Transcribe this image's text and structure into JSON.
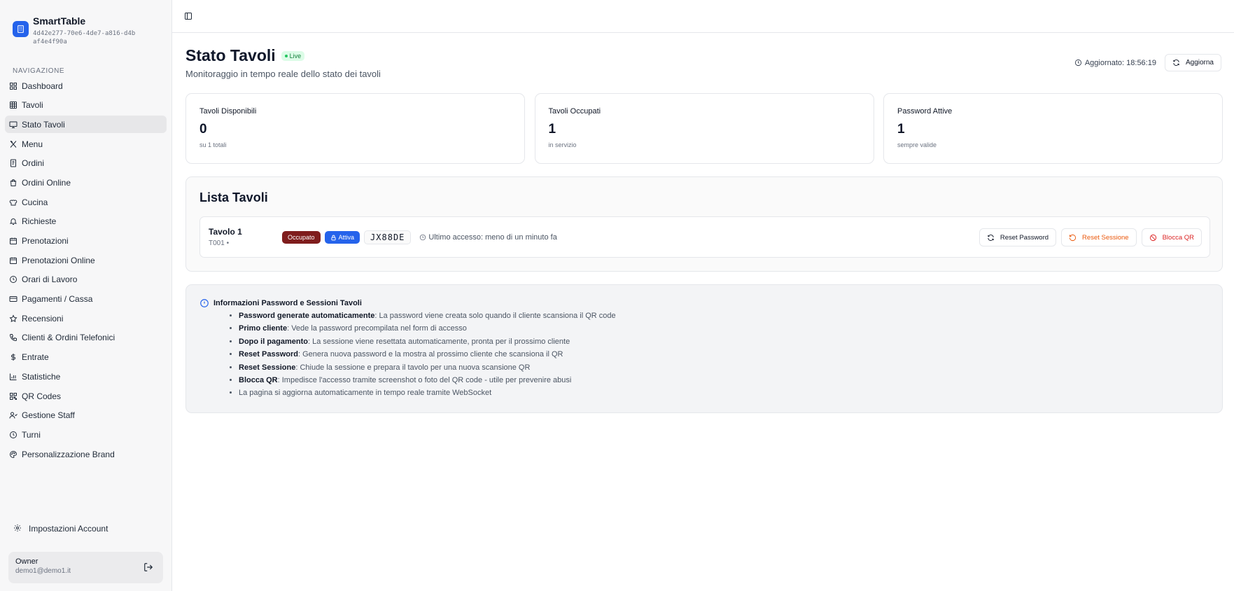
{
  "brand": {
    "name": "SmartTable",
    "id": "4d42e277-70e6-4de7-a816-d4baf4e4f90a"
  },
  "nav": {
    "title": "NAVIGAZIONE",
    "items": [
      {
        "label": "Dashboard",
        "icon": "grid-icon"
      },
      {
        "label": "Tavoli",
        "icon": "table-icon"
      },
      {
        "label": "Stato Tavoli",
        "icon": "monitor-icon",
        "active": true
      },
      {
        "label": "Menu",
        "icon": "utensils-icon"
      },
      {
        "label": "Ordini",
        "icon": "receipt-icon"
      },
      {
        "label": "Ordini Online",
        "icon": "shopping-bag-icon"
      },
      {
        "label": "Cucina",
        "icon": "chef-hat-icon"
      },
      {
        "label": "Richieste",
        "icon": "bell-icon"
      },
      {
        "label": "Prenotazioni",
        "icon": "calendar-icon"
      },
      {
        "label": "Prenotazioni Online",
        "icon": "calendar-icon"
      },
      {
        "label": "Orari di Lavoro",
        "icon": "clock-icon"
      },
      {
        "label": "Pagamenti / Cassa",
        "icon": "credit-card-icon"
      },
      {
        "label": "Recensioni",
        "icon": "star-icon"
      },
      {
        "label": "Clienti & Ordini Telefonici",
        "icon": "phone-icon"
      },
      {
        "label": "Entrate",
        "icon": "dollar-icon"
      },
      {
        "label": "Statistiche",
        "icon": "bar-chart-icon"
      },
      {
        "label": "QR Codes",
        "icon": "qr-code-icon"
      },
      {
        "label": "Gestione Staff",
        "icon": "users-icon"
      },
      {
        "label": "Turni",
        "icon": "clock-icon"
      },
      {
        "label": "Personalizzazione Brand",
        "icon": "palette-icon"
      }
    ]
  },
  "account": {
    "settings_label": "Impostazioni Account"
  },
  "user": {
    "name": "Owner",
    "email": "demo1@demo1.it"
  },
  "header": {
    "title": "Stato Tavoli",
    "live_label": "Live",
    "subtitle": "Monitoraggio in tempo reale dello stato dei tavoli",
    "updated_label": "Aggiornato: 18:56:19",
    "refresh_label": "Aggiorna"
  },
  "stats": [
    {
      "label": "Tavoli Disponibili",
      "value": "0",
      "sub": "su 1 totali"
    },
    {
      "label": "Tavoli Occupati",
      "value": "1",
      "sub": "in servizio"
    },
    {
      "label": "Password Attive",
      "value": "1",
      "sub": "sempre valide"
    }
  ],
  "list": {
    "title": "Lista Tavoli",
    "rows": [
      {
        "name": "Tavolo 1",
        "code": "T001 •",
        "status": "Occupato",
        "password_status": "Attiva",
        "password": "JX88DE",
        "last_access": "Ultimo accesso: meno di un minuto fa",
        "actions": {
          "reset_password": "Reset Password",
          "reset_session": "Reset Sessione",
          "block_qr": "Blocca QR"
        }
      }
    ]
  },
  "info": {
    "title": "Informazioni Password e Sessioni Tavoli",
    "items": [
      {
        "bold": "Password generate automaticamente",
        "text": ": La password viene creata solo quando il cliente scansiona il QR code"
      },
      {
        "bold": "Primo cliente",
        "text": ": Vede la password precompilata nel form di accesso"
      },
      {
        "bold": "Dopo il pagamento",
        "text": ": La sessione viene resettata automaticamente, pronta per il prossimo cliente"
      },
      {
        "bold": "Reset Password",
        "text": ": Genera nuova password e la mostra al prossimo cliente che scansiona il QR"
      },
      {
        "bold": "Reset Sessione",
        "text": ": Chiude la sessione e prepara il tavolo per una nuova scansione QR"
      },
      {
        "bold": "Blocca QR",
        "text": ": Impedisce l'accesso tramite screenshot o foto del QR code - utile per prevenire abusi"
      },
      {
        "bold": "",
        "text": "La pagina si aggiorna automaticamente in tempo reale tramite WebSocket"
      }
    ]
  },
  "colors": {
    "accent": "#2563eb",
    "occupied": "#7f1d1d",
    "live": "#15803d",
    "warning": "#ea580c",
    "danger": "#dc2626"
  }
}
